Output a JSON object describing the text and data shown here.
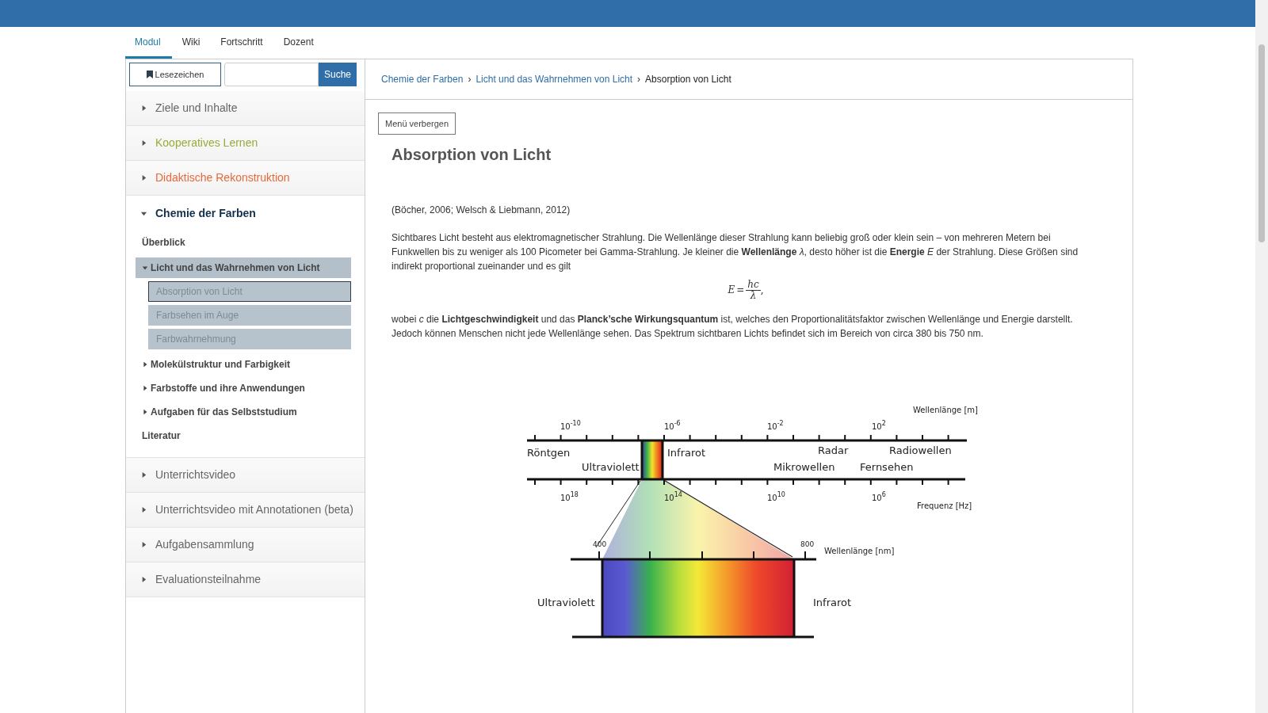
{
  "tabs": [
    {
      "label": "Modul",
      "selected": true
    },
    {
      "label": "Wiki",
      "selected": false
    },
    {
      "label": "Fortschritt",
      "selected": false
    },
    {
      "label": "Dozent",
      "selected": false
    }
  ],
  "sidebar": {
    "bookmark_button": "Lesezeichen",
    "search_button": "Suche",
    "sections": [
      {
        "label": "Ziele und Inhalte",
        "color": "#666666",
        "expanded": false
      },
      {
        "label": "Kooperatives Lernen",
        "color": "#9aab3a",
        "expanded": false
      },
      {
        "label": "Didaktische Rekonstruktion",
        "color": "#e8693a",
        "expanded": false
      },
      {
        "label": "Chemie der Farben",
        "color": "#12304e",
        "expanded": true,
        "children": [
          {
            "kind": "link",
            "label": "Überblick"
          },
          {
            "kind": "group",
            "label": "Licht und das Wahrnehmen von Licht",
            "expanded": true,
            "children": [
              {
                "label": "Absorption von Licht",
                "selected": true
              },
              {
                "label": "Farbsehen im Auge",
                "selected": false
              },
              {
                "label": "Farbwahrnehmung",
                "selected": false
              }
            ]
          },
          {
            "kind": "group",
            "label": "Molekülstruktur und Farbigkeit",
            "expanded": false
          },
          {
            "kind": "group",
            "label": "Farbstoffe und ihre Anwendungen",
            "expanded": false
          },
          {
            "kind": "group",
            "label": "Aufgaben für das Selbststudium",
            "expanded": false
          },
          {
            "kind": "link",
            "label": "Literatur"
          }
        ]
      },
      {
        "label": "Unterrichtsvideo",
        "color": "#666666",
        "expanded": false
      },
      {
        "label": "Unterrichtsvideo mit Annotationen (beta)",
        "color": "#666666",
        "expanded": false
      },
      {
        "label": "Aufgabensammlung",
        "color": "#666666",
        "expanded": false
      },
      {
        "label": "Evaluationsteilnahme",
        "color": "#666666",
        "expanded": false
      }
    ]
  },
  "breadcrumb": [
    {
      "kind": "link",
      "text": "Chemie der Farben"
    },
    {
      "kind": "separator",
      "text": "›"
    },
    {
      "kind": "link",
      "text": "Licht und das Wahrnehmen von Licht"
    },
    {
      "kind": "separator",
      "text": "›"
    },
    {
      "kind": "current",
      "text": "Absorption von Licht"
    }
  ],
  "hide_menu_button": "Menü verbergen",
  "title": "Absorption von Licht",
  "citation": "(Böcher, 2006; Welsch & Liebmann, 2012)",
  "paragraph_1": "Sichtbares Licht besteht aus elektromagnetischer Strahlung. Die Wellenlänge dieser Strahlung kann beliebig groß oder klein sein – von mehreren Metern bei Funkwellen bis zu weniger als 100 Picometer bei Gamma-Strahlung. Je kleiner die **Wellenlänge** *λ*, desto höher ist die **Energie** *E* der Strahlung. Diese Größen sind indirekt proportional zueinander und es gilt",
  "formula": {
    "lhs": "E",
    "equals": "=",
    "numerator": "hc",
    "denominator": "λ",
    "trail": ","
  },
  "paragraph_2": "wobei *c* die **Lichtgeschwindigkeit** und das **Planck’sche Wirkungsquantum** ist, welches den Proportionalitätsfaktor zwischen Wellenlänge und Energie darstellt. Jedoch können Menschen nicht jede Wellenlänge sehen. Das Spektrum sichtbaren Lichts befindet sich im Bereich von circa 380 bis 750 nm.",
  "figure": {
    "top_unit": "Wellenlänge [m]",
    "top_ticks": [
      {
        "base": "10",
        "exp": "-10"
      },
      {
        "base": "10",
        "exp": "-6"
      },
      {
        "base": "10",
        "exp": "-2"
      },
      {
        "base": "10",
        "exp": "2"
      }
    ],
    "bands": [
      "Röntgen",
      "Ultraviolett",
      "Infrarot",
      "Radar",
      "Mikrowellen",
      "Fernsehen",
      "Radiowellen"
    ],
    "bottom_ticks": [
      {
        "base": "10",
        "exp": "18"
      },
      {
        "base": "10",
        "exp": "14"
      },
      {
        "base": "10",
        "exp": "10"
      },
      {
        "base": "10",
        "exp": "6"
      }
    ],
    "bottom_unit": "Frequenz [Hz]",
    "visible_ticks": [
      "400",
      "800"
    ],
    "visible_unit": "Wellenlänge [nm]",
    "left_label": "Ultraviolett",
    "right_label": "Infrarot"
  }
}
